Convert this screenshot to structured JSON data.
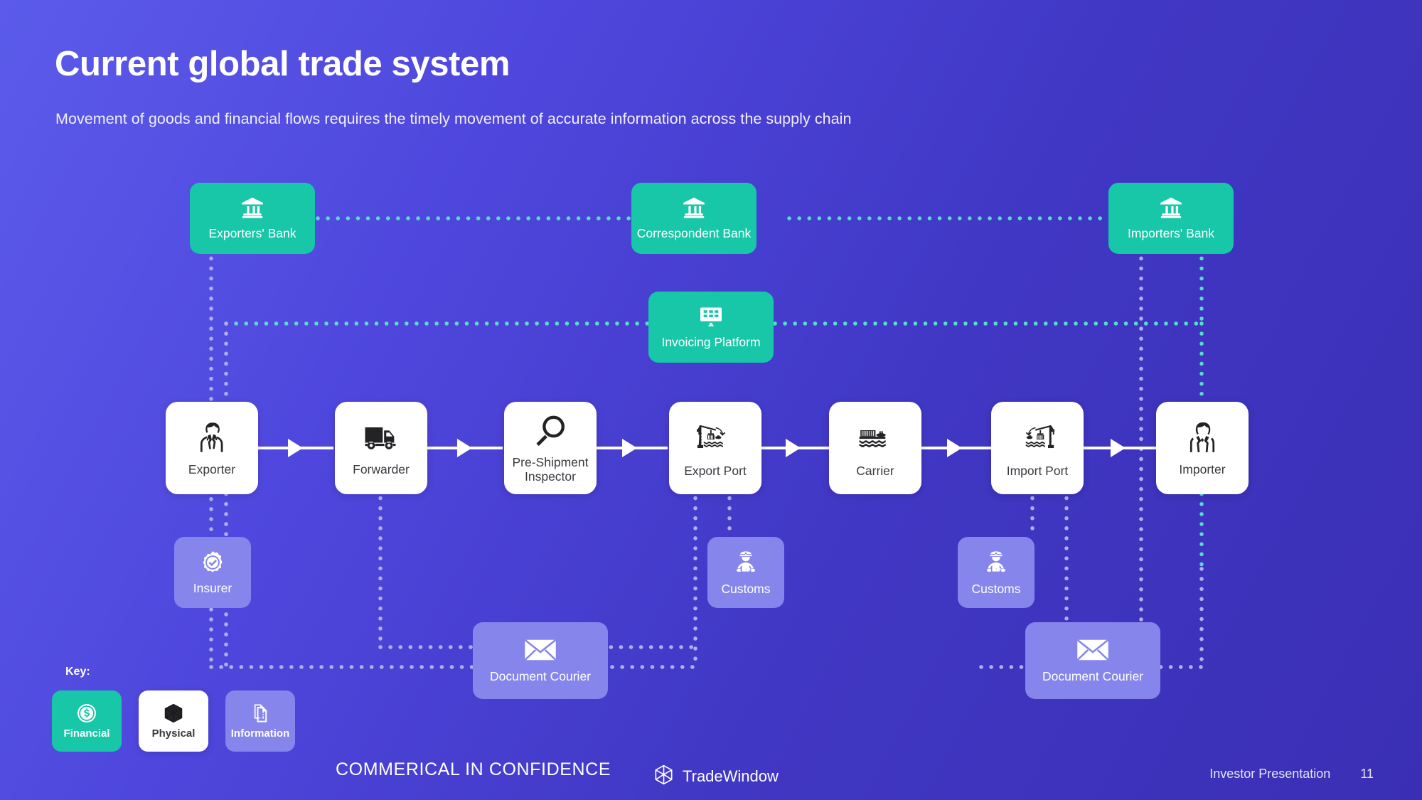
{
  "header": {
    "title": "Current global trade system",
    "subtitle": "Movement of goods and financial flows requires the timely movement of accurate information across the supply chain"
  },
  "colors": {
    "financial": "#17c7a8",
    "physical": "#ffffff",
    "information": "#8585ec",
    "background_from": "#5b5bea",
    "background_to": "#3a2fb4",
    "wire_information": "#afaff2",
    "wire_financial": "#5ad9cd",
    "arrow": "#ffffff"
  },
  "banks": [
    {
      "label": "Exporters' Bank",
      "icon": "bank-icon",
      "type": "financial"
    },
    {
      "label": "Correspondent Bank",
      "icon": "bank-icon",
      "type": "financial"
    },
    {
      "label": "Importers' Bank",
      "icon": "bank-icon",
      "type": "financial"
    }
  ],
  "platform": {
    "label": "Invoicing Platform",
    "icon": "monitor-grid-icon",
    "type": "financial"
  },
  "chain": [
    {
      "label": "Exporter",
      "icon": "businessman-icon",
      "type": "physical"
    },
    {
      "label": "Forwarder",
      "icon": "truck-icon",
      "type": "physical"
    },
    {
      "label": "Pre-Shipment\nInspector",
      "icon": "magnifier-icon",
      "type": "physical"
    },
    {
      "label": "Export Port",
      "icon": "crane-loading-icon",
      "type": "physical"
    },
    {
      "label": "Carrier",
      "icon": "cargo-ship-icon",
      "type": "physical"
    },
    {
      "label": "Import Port",
      "icon": "crane-unloading-icon",
      "type": "physical"
    },
    {
      "label": "Importer",
      "icon": "businesswoman-icon",
      "type": "physical"
    }
  ],
  "support": [
    {
      "label": "Insurer",
      "icon": "badge-check-icon",
      "type": "information"
    },
    {
      "label": "Customs",
      "icon": "customs-officer-icon",
      "type": "information"
    },
    {
      "label": "Customs",
      "icon": "customs-officer-icon",
      "type": "information"
    }
  ],
  "couriers": [
    {
      "label": "Document Courier",
      "icon": "envelope-icon",
      "type": "information"
    },
    {
      "label": "Document Courier",
      "icon": "envelope-icon",
      "type": "information"
    }
  ],
  "key": {
    "title": "Key:",
    "items": [
      {
        "label": "Financial",
        "icon": "dollar-coin-icon",
        "type": "financial"
      },
      {
        "label": "Physical",
        "icon": "cube-icon",
        "type": "physical"
      },
      {
        "label": "Information",
        "icon": "document-icon",
        "type": "information"
      }
    ]
  },
  "footer": {
    "confidentiality": "COMMERICAL IN CONFIDENCE",
    "brand": "TradeWindow",
    "brand_icon": "tradewindow-logo-icon",
    "deck": "Investor Presentation",
    "page": "11"
  }
}
